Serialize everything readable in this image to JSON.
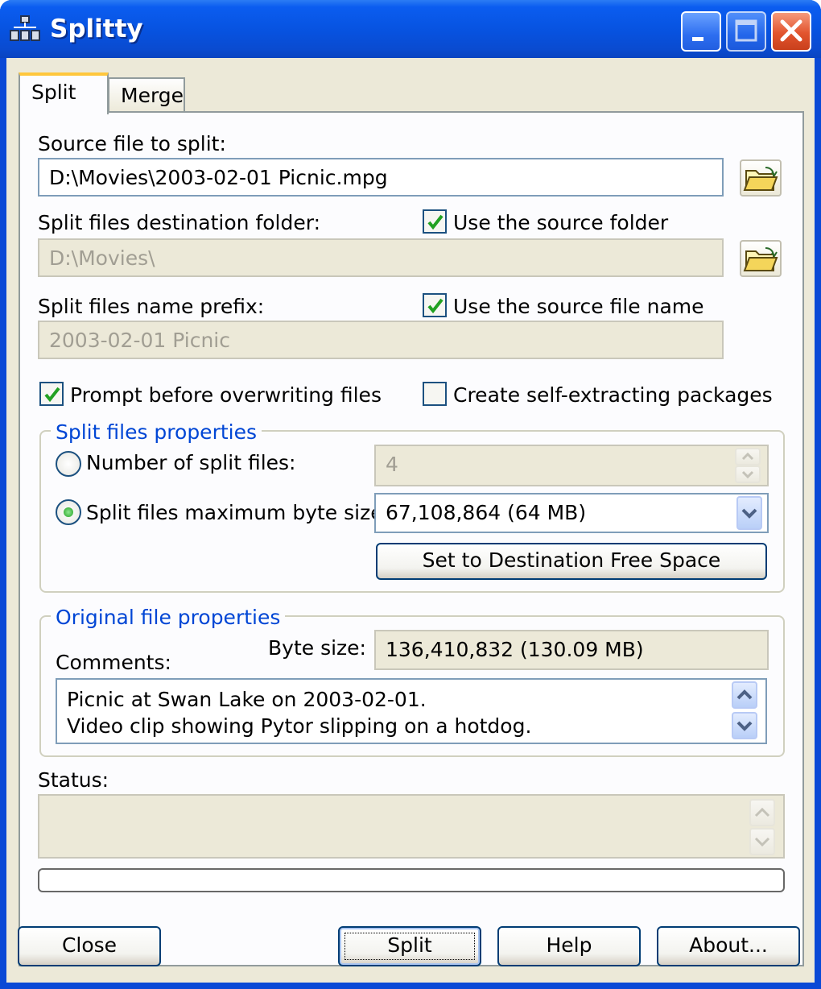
{
  "window": {
    "title": "Splitty",
    "minimize": "minimize",
    "maximize": "maximize",
    "close": "close"
  },
  "tabs": [
    {
      "label": "Split",
      "active": true
    },
    {
      "label": "Merge",
      "active": false
    }
  ],
  "source": {
    "label": "Source file to split:",
    "value": "D:\\Movies\\2003-02-01 Picnic.mpg"
  },
  "destination": {
    "label": "Split files destination folder:",
    "value": "D:\\Movies\\",
    "use_source_label": "Use the source folder",
    "use_source_checked": true
  },
  "prefix": {
    "label": "Split files name prefix:",
    "value": "2003-02-01 Picnic",
    "use_source_label": "Use the source file name",
    "use_source_checked": true
  },
  "options": {
    "prompt_label": "Prompt before overwriting files",
    "prompt_checked": true,
    "sfx_label": "Create self-extracting packages",
    "sfx_checked": false
  },
  "split_props": {
    "title": "Split files properties",
    "number_label": "Number of split files:",
    "number_value": "4",
    "size_label": "Split files maximum byte size:",
    "size_value": "67,108,864 (64 MB)",
    "set_button": "Set to Destination Free Space"
  },
  "original_props": {
    "title": "Original file properties",
    "byte_size_label": "Byte size:",
    "byte_size_value": "136,410,832 (130.09 MB)",
    "comments_label": "Comments:",
    "comments_line1": "Picnic at Swan Lake on 2003-02-01.",
    "comments_line2": "Video clip showing Pytor slipping on a hotdog."
  },
  "status": {
    "label": "Status:",
    "text": "",
    "progress": 0
  },
  "buttons": {
    "close": "Close",
    "split": "Split",
    "help": "Help",
    "about": "About..."
  },
  "colors": {
    "titlebar": "#0752df",
    "face": "#ece9d8",
    "group_title": "#0046d5",
    "check": "#21a121"
  }
}
